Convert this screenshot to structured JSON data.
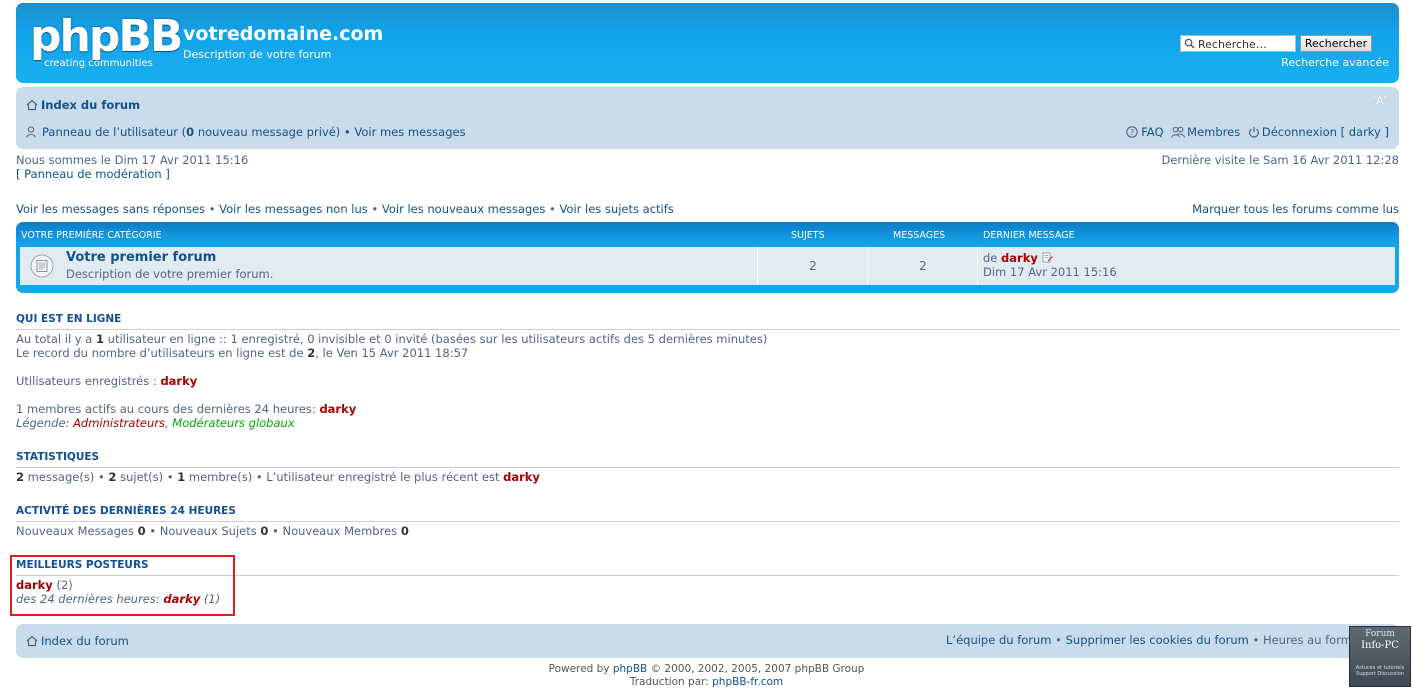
{
  "header": {
    "logo_main": "phpBB",
    "logo_sub": "creating communities",
    "site_title": "votredomaine.com",
    "site_description": "Description de votre forum",
    "search_placeholder": "Recherche…",
    "search_button": "Rechercher",
    "advanced_search": "Recherche avancée"
  },
  "navbar": {
    "index_label": "Index du forum",
    "font_size_label": "A",
    "ucp_label": "Panneau de l’utilisateur",
    "pm_open": " (",
    "pm_count": "0",
    "pm_text": " nouveau message privé)",
    "sep": " • ",
    "view_messages": "Voir mes messages",
    "faq": "FAQ",
    "members": "Membres",
    "logout": "Déconnexion [ darky ]"
  },
  "info": {
    "today": "Nous sommes le Dim 17 Avr 2011 15:16",
    "moderation_panel": "[ Panneau de modération ]",
    "last_visit": "Dernière visite le Sam 16 Avr 2011 12:28"
  },
  "quicklinks": {
    "unanswered": "Voir les messages sans réponses",
    "unread": "Voir les messages non lus",
    "new_posts": "Voir les nouveaux messages",
    "active_topics": "Voir les sujets actifs",
    "sep": " • ",
    "mark_read": "Marquer tous les forums comme lus"
  },
  "forum_table": {
    "headers": {
      "category": "Votre première catégorie",
      "topics": "Sujets",
      "posts": "Messages",
      "last_post": "Dernier message"
    },
    "rows": [
      {
        "title": "Votre premier forum",
        "description": "Description de votre premier forum.",
        "topics": "2",
        "posts": "2",
        "last_post_by": "de ",
        "last_post_user": "darky",
        "last_post_date": "Dim 17 Avr 2011 15:16"
      }
    ]
  },
  "online": {
    "heading": "Qui est en ligne",
    "total_1": "Au total il y a ",
    "total_n": "1",
    "total_2": " utilisateur en ligne :: 1 enregistré, 0 invisible et 0 invité (basées sur les utilisateurs actifs des 5 dernières minutes)",
    "record_1": "Le record du nombre d’utilisateurs en ligne est de ",
    "record_n": "2",
    "record_2": ", le Ven 15 Avr 2011 18:57",
    "registered_label": "Utilisateurs enregistrés : ",
    "registered_user": "darky",
    "active24_label": "1 membres actifs au cours des dernières 24 heures: ",
    "active24_user": "darky",
    "legend_label": "Légende: ",
    "legend_admin": "Administrateurs",
    "legend_comma": ", ",
    "legend_gmod": "Modérateurs globaux"
  },
  "stats": {
    "heading": "Statistiques",
    "posts_n": "2",
    "posts_t": " message(s) • ",
    "topics_n": "2",
    "topics_t": " sujet(s) • ",
    "members_n": "1",
    "members_t": " membre(s) • L’utilisateur enregistré le plus récent est ",
    "newest_user": "darky"
  },
  "activity": {
    "heading": "Activité des dernières 24 heures",
    "new_messages_label": "Nouveaux Messages ",
    "new_messages_n": "0",
    "new_topics_label": " • Nouveaux Sujets ",
    "new_topics_n": "0",
    "new_members_label": " • Nouveaux Membres ",
    "new_members_n": "0"
  },
  "top_posters": {
    "heading": "Meilleurs posteurs",
    "user": "darky",
    "count": " (2)",
    "last24_label": "des 24 dernières heures: ",
    "last24_user": "darky",
    "last24_count": " (1)"
  },
  "footer": {
    "index_label": "Index du forum",
    "team": "L’équipe du forum",
    "sep": " • ",
    "delete_cookies": "Supprimer les cookies du forum",
    "timezone": "Heures au format",
    "powered_prefix": "Powered by ",
    "powered_link": "phpBB",
    "powered_suffix": " © 2000, 2002, 2005, 2007 phpBB Group",
    "translation_prefix": "Traduction par: ",
    "translation_link": "phpBB-fr.com"
  },
  "badge": {
    "line1": "Forum",
    "line2": "Info-PC",
    "line3": "Astuces et tutoriels Support Discussion"
  },
  "colors": {
    "header_blue": "#12a3eb",
    "navbar_bg": "#cadceb",
    "row_bg": "#e1ebf2",
    "link": "#105289",
    "admin_red": "#AA0000",
    "gmod_green": "#00AA00",
    "highlight_red": "#e11d1d"
  }
}
